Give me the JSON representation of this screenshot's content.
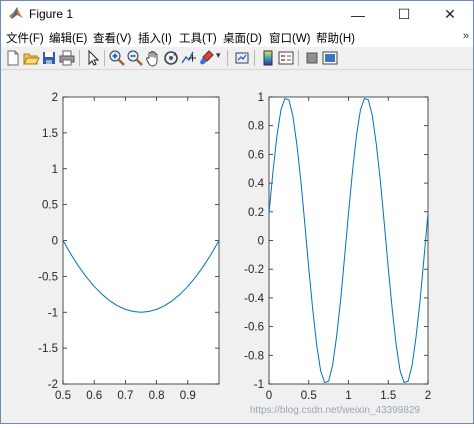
{
  "window": {
    "title": "Figure 1",
    "controls": {
      "minimize": "—",
      "maximize": "☐",
      "close": "✕"
    }
  },
  "menubar": {
    "items": [
      "文件(F)",
      "编辑(E)",
      "查看(V)",
      "插入(I)",
      "工具(T)",
      "桌面(D)",
      "窗口(W)",
      "帮助(H)"
    ],
    "overflow": "»"
  },
  "toolbar": {
    "icons": [
      "new-figure-icon",
      "open-file-icon",
      "save-icon",
      "print-icon",
      "pointer-icon",
      "zoom-in-icon",
      "zoom-out-icon",
      "pan-hand-icon",
      "rotate-3d-icon",
      "data-cursor-icon",
      "brush-icon",
      "link-plot-icon",
      "colorbar-icon",
      "legend-icon",
      "hide-plot-tools-icon",
      "show-plot-tools-icon"
    ]
  },
  "watermark": "https://blog.csdn.net/weixin_43399829",
  "colors": {
    "line": "#0072bd",
    "axes_bg": "#ffffff",
    "figure_bg": "#f0f0f0"
  },
  "chart_data": [
    {
      "type": "line",
      "title": "",
      "xlabel": "",
      "ylabel": "",
      "xlim": [
        0.5,
        1.0
      ],
      "ylim": [
        -2,
        2
      ],
      "xticks": [
        "0.5",
        "0.6",
        "0.7",
        "0.8",
        "0.9"
      ],
      "yticks": [
        "2",
        "1.5",
        "1",
        "0.5",
        "0",
        "-0.5",
        "-1",
        "-1.5",
        "-2"
      ],
      "grid": false,
      "series": [
        {
          "color": "#0072bd",
          "x": [
            0.5,
            0.525,
            0.55,
            0.575,
            0.6,
            0.625,
            0.65,
            0.675,
            0.7,
            0.725,
            0.75,
            0.775,
            0.8,
            0.825,
            0.85,
            0.875,
            0.9,
            0.925,
            0.95,
            0.975,
            1.0
          ],
          "y": [
            0,
            -0.19,
            -0.36,
            -0.51,
            -0.64,
            -0.75,
            -0.84,
            -0.91,
            -0.96,
            -0.99,
            -1.0,
            -0.99,
            -0.96,
            -0.91,
            -0.84,
            -0.75,
            -0.64,
            -0.51,
            -0.36,
            -0.19,
            0
          ]
        }
      ]
    },
    {
      "type": "line",
      "title": "",
      "xlabel": "",
      "ylabel": "",
      "xlim": [
        0,
        2
      ],
      "ylim": [
        -1,
        1
      ],
      "xticks": [
        "0",
        "0.5",
        "1",
        "1.5",
        "2"
      ],
      "yticks": [
        "1",
        "0.8",
        "0.6",
        "0.4",
        "0.2",
        "0",
        "-0.2",
        "-0.4",
        "-0.6",
        "-0.8",
        "-1"
      ],
      "grid": false,
      "series": [
        {
          "color": "#0072bd",
          "x": [
            0,
            0.05,
            0.1,
            0.15,
            0.2,
            0.25,
            0.3,
            0.35,
            0.4,
            0.45,
            0.5,
            0.55,
            0.6,
            0.65,
            0.7,
            0.75,
            0.8,
            0.85,
            0.9,
            0.95,
            1.0,
            1.05,
            1.1,
            1.15,
            1.2,
            1.25,
            1.3,
            1.35,
            1.4,
            1.45,
            1.5,
            1.55,
            1.6,
            1.65,
            1.7,
            1.75,
            1.8,
            1.85,
            1.9,
            1.95,
            2.0
          ],
          "y": [
            0.19,
            0.48,
            0.73,
            0.91,
            0.99,
            0.98,
            0.87,
            0.67,
            0.42,
            0.12,
            -0.19,
            -0.48,
            -0.73,
            -0.91,
            -0.99,
            -0.98,
            -0.87,
            -0.67,
            -0.42,
            -0.12,
            0.19,
            0.48,
            0.73,
            0.91,
            0.99,
            0.98,
            0.87,
            0.67,
            0.42,
            0.12,
            -0.19,
            -0.48,
            -0.73,
            -0.91,
            -0.99,
            -0.98,
            -0.87,
            -0.67,
            -0.42,
            -0.12,
            0.19
          ]
        }
      ]
    }
  ]
}
